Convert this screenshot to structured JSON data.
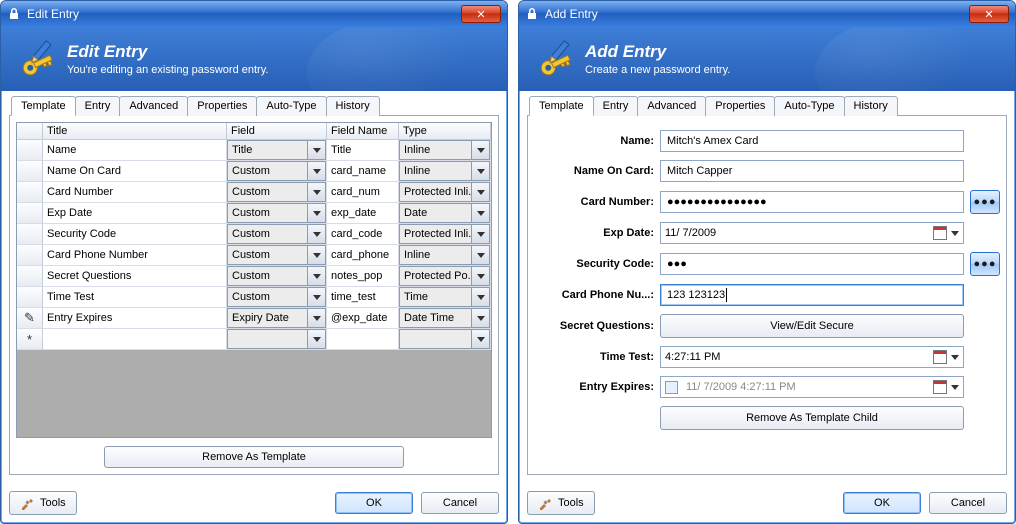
{
  "left": {
    "window_title": "Edit Entry",
    "header_title": "Edit Entry",
    "header_sub": "You're editing an existing password entry.",
    "tabs": [
      "Template",
      "Entry",
      "Advanced",
      "Properties",
      "Auto-Type",
      "History"
    ],
    "active_tab": 0,
    "columns": [
      "",
      "Title",
      "Field",
      "Field Name",
      "Type"
    ],
    "rows": [
      {
        "marker": "",
        "title": "Name",
        "field": "Title",
        "field_name": "Title",
        "type": "Inline"
      },
      {
        "marker": "",
        "title": "Name On Card",
        "field": "Custom",
        "field_name": "card_name",
        "type": "Inline"
      },
      {
        "marker": "",
        "title": "Card Number",
        "field": "Custom",
        "field_name": "card_num",
        "type": "Protected Inli..."
      },
      {
        "marker": "",
        "title": "Exp Date",
        "field": "Custom",
        "field_name": "exp_date",
        "type": "Date"
      },
      {
        "marker": "",
        "title": "Security Code",
        "field": "Custom",
        "field_name": "card_code",
        "type": "Protected Inli..."
      },
      {
        "marker": "",
        "title": "Card Phone Number",
        "field": "Custom",
        "field_name": "card_phone",
        "type": "Inline"
      },
      {
        "marker": "",
        "title": "Secret Questions",
        "field": "Custom",
        "field_name": "notes_pop",
        "type": "Protected Po..."
      },
      {
        "marker": "",
        "title": "Time Test",
        "field": "Custom",
        "field_name": "time_test",
        "type": "Time"
      },
      {
        "marker": "✎",
        "title": "Entry Expires",
        "field": "Expiry Date",
        "field_name": "@exp_date",
        "type": "Date Time"
      },
      {
        "marker": "*",
        "title": "",
        "field": "",
        "field_name": "",
        "type": ""
      }
    ],
    "remove_btn": "Remove As Template",
    "tools": "Tools",
    "ok": "OK",
    "cancel": "Cancel"
  },
  "right": {
    "window_title": "Add Entry",
    "header_title": "Add Entry",
    "header_sub": "Create a new password entry.",
    "tabs": [
      "Template",
      "Entry",
      "Advanced",
      "Properties",
      "Auto-Type",
      "History"
    ],
    "active_tab": 0,
    "fields": {
      "name_label": "Name:",
      "name_value": "Mitch's Amex Card",
      "name_on_card_label": "Name On Card:",
      "name_on_card_value": "Mitch Capper",
      "card_number_label": "Card Number:",
      "card_number_value": "●●●●●●●●●●●●●●●",
      "exp_date_label": "Exp Date:",
      "exp_date_value": "11/  7/2009",
      "security_code_label": "Security Code:",
      "security_code_value": "●●●",
      "card_phone_label": "Card Phone Nu...:",
      "card_phone_value": "123 123123",
      "secret_q_label": "Secret Questions:",
      "secret_q_btn": "View/Edit Secure",
      "time_test_label": "Time Test:",
      "time_test_value": "4:27:11 PM",
      "expires_label": "Entry Expires:",
      "expires_value": "11/  7/2009   4:27:11 PM",
      "remove_child_btn": "Remove As Template Child"
    },
    "reveal_glyph": "●●●",
    "tools": "Tools",
    "ok": "OK",
    "cancel": "Cancel"
  }
}
